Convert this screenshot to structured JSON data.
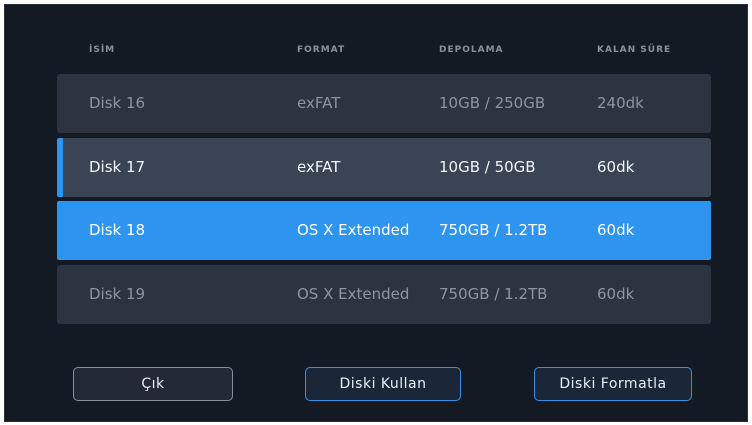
{
  "header": {
    "name": "İSİM",
    "format": "FORMAT",
    "storage": "DEPOLAMA",
    "remaining": "KALAN SÜRE"
  },
  "disks": [
    {
      "name": "Disk 16",
      "format": "exFAT",
      "storage": "10GB / 250GB",
      "remaining": "240dk",
      "state": "dim"
    },
    {
      "name": "Disk 17",
      "format": "exFAT",
      "storage": "10GB / 50GB",
      "remaining": "60dk",
      "state": "highlighted"
    },
    {
      "name": "Disk 18",
      "format": "OS X Extended",
      "storage": "750GB / 1.2TB",
      "remaining": "60dk",
      "state": "selected"
    },
    {
      "name": "Disk 19",
      "format": "OS X Extended",
      "storage": "750GB / 1.2TB",
      "remaining": "60dk",
      "state": "dim"
    }
  ],
  "buttons": {
    "exit": "Çık",
    "use_disk": "Diski Kullan",
    "format_disk": "Diski Formatla"
  },
  "colors": {
    "background": "#141a24",
    "row": "#2c3442",
    "row_highlighted": "#3b4455",
    "accent": "#2d94ef"
  }
}
